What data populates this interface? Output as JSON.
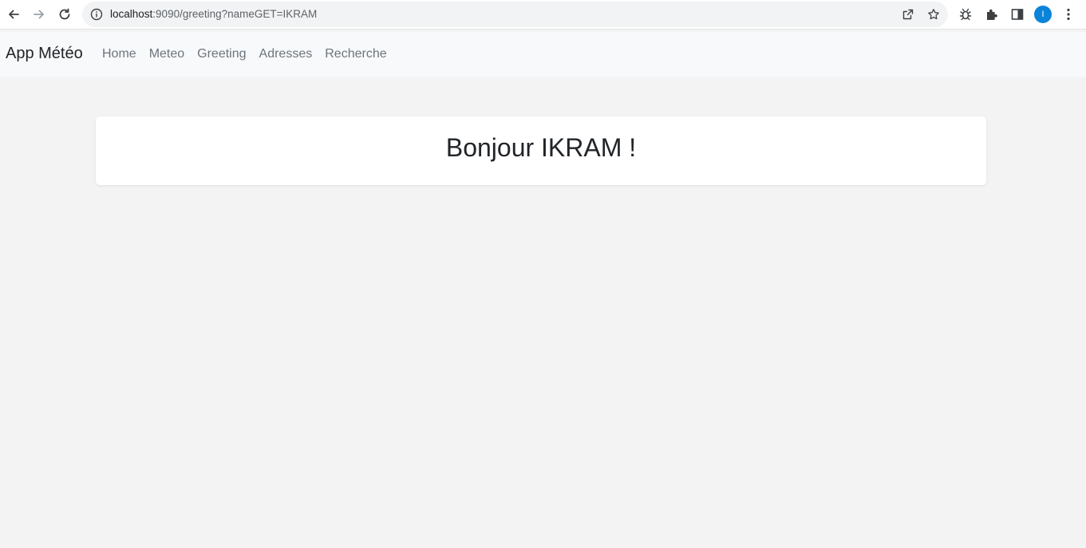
{
  "browser": {
    "url_host": "localhost",
    "url_path": ":9090/greeting?nameGET=IKRAM",
    "avatar_letter": "I"
  },
  "navbar": {
    "brand": "App Météo",
    "links": [
      "Home",
      "Meteo",
      "Greeting",
      "Adresses",
      "Recherche"
    ]
  },
  "main": {
    "greeting": "Bonjour IKRAM !"
  },
  "icons": {
    "back": "back-arrow-icon",
    "forward": "forward-arrow-icon",
    "reload": "reload-icon",
    "info": "info-icon",
    "share": "share-icon",
    "bookmark": "star-icon",
    "extension1": "bug-extension-icon",
    "extensions": "puzzle-icon",
    "side_panel": "side-panel-icon",
    "menu": "kebab-menu-icon"
  },
  "colors": {
    "accent": "#0b83d9",
    "background": "#f3f3f3",
    "navbar": "#f8f9fa"
  }
}
